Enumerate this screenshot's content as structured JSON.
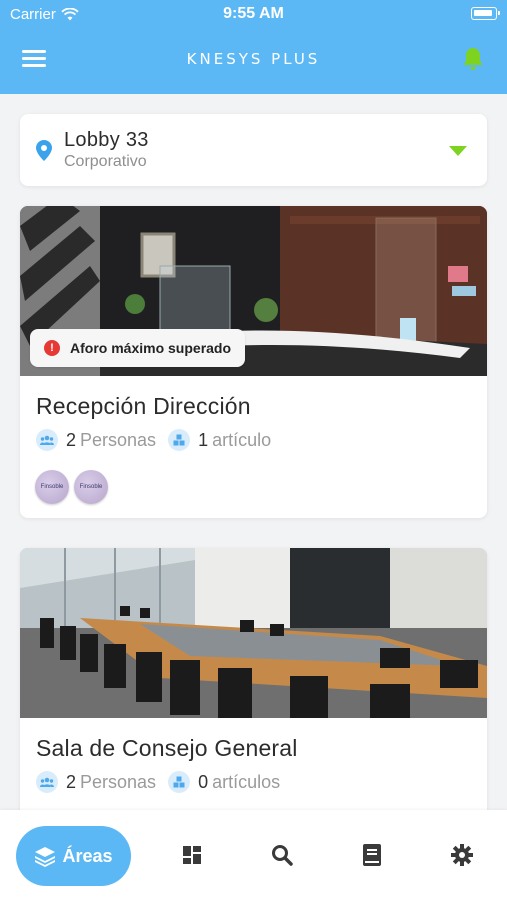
{
  "status_bar": {
    "carrier": "Carrier",
    "time": "9:55 AM"
  },
  "header": {
    "title": "KNESYS PLUS",
    "menu_icon": "hamburger-icon",
    "bell_icon": "bell-icon"
  },
  "location": {
    "name": "Lobby 33",
    "subtitle": "Corporativo",
    "icon": "location-pin-icon"
  },
  "areas": [
    {
      "title": "Recepción Dirección",
      "people_count": "2",
      "people_label": "Personas",
      "items_count": "1",
      "items_label": "artículo",
      "alert": "Aforo máximo superado",
      "avatar_labels": [
        "Finsoble",
        "Finsoble"
      ]
    },
    {
      "title": "Sala de Consejo General",
      "people_count": "2",
      "people_label": "Personas",
      "items_count": "0",
      "items_label": "artículos"
    }
  ],
  "bottom_nav": {
    "active_label": "Áreas",
    "items": [
      "areas-icon",
      "dashboard-icon",
      "search-icon",
      "book-icon",
      "gear-icon"
    ]
  },
  "colors": {
    "primary": "#5bb8f5",
    "accent": "#7ed321",
    "alert": "#e53935"
  }
}
